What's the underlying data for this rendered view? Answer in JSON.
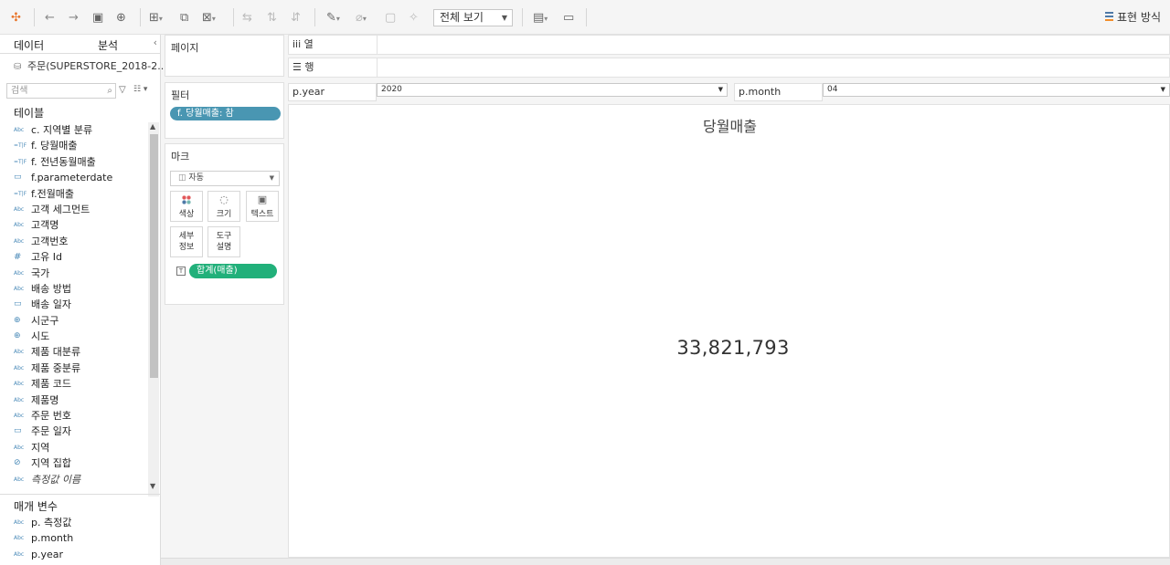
{
  "toolbar": {
    "icons": [
      "tableau-logo-icon",
      "undo-icon",
      "redo-icon",
      "save-icon",
      "new-datasource-icon",
      "new-worksheet-icon",
      "duplicate-icon",
      "clear-icon",
      "swap-icon",
      "sort-asc-icon",
      "sort-desc-icon",
      "highlight-icon",
      "group-icon",
      "label-icon",
      "pin-icon",
      "show-cards-icon",
      "presentation-icon"
    ],
    "view_mode": "전체 보기",
    "show_me": "표현 방식"
  },
  "data_pane": {
    "tab_data": "데이터",
    "tab_analysis": "분석",
    "datasource": "주문(SUPERSTORE_2018-2...",
    "search_placeholder": "검색",
    "tables_title": "테이블",
    "fields": [
      {
        "type": "Abc",
        "icon": "string-calc-icon",
        "label": "c. 지역별 분류"
      },
      {
        "type": "T|F",
        "icon": "boolean-calc-icon",
        "label": "f. 당월매출"
      },
      {
        "type": "T|F",
        "icon": "boolean-calc-icon",
        "label": "f. 전년동월매출"
      },
      {
        "type": "date",
        "icon": "date-calc-icon",
        "label": "f.parameterdate"
      },
      {
        "type": "T|F",
        "icon": "boolean-calc-icon",
        "label": "f.전월매출"
      },
      {
        "type": "Abc",
        "icon": "string-icon",
        "label": "고객 세그먼트"
      },
      {
        "type": "Abc",
        "icon": "string-icon",
        "label": "고객명"
      },
      {
        "type": "Abc",
        "icon": "string-icon",
        "label": "고객번호"
      },
      {
        "type": "#",
        "icon": "number-icon",
        "label": "고유 Id"
      },
      {
        "type": "Abc",
        "icon": "string-icon",
        "label": "국가"
      },
      {
        "type": "Abc",
        "icon": "string-icon",
        "label": "배송 방법"
      },
      {
        "type": "date",
        "icon": "date-icon",
        "label": "배송 일자"
      },
      {
        "type": "geo",
        "icon": "globe-icon",
        "label": "시군구"
      },
      {
        "type": "geo",
        "icon": "globe-icon",
        "label": "시도"
      },
      {
        "type": "Abc",
        "icon": "string-icon",
        "label": "제품 대분류"
      },
      {
        "type": "Abc",
        "icon": "string-icon",
        "label": "제품 중분류"
      },
      {
        "type": "Abc",
        "icon": "string-icon",
        "label": "제품 코드"
      },
      {
        "type": "Abc",
        "icon": "string-icon",
        "label": "제품명"
      },
      {
        "type": "Abc",
        "icon": "string-icon",
        "label": "주문 번호"
      },
      {
        "type": "date",
        "icon": "date-icon",
        "label": "주문 일자"
      },
      {
        "type": "Abc",
        "icon": "string-icon",
        "label": "지역"
      },
      {
        "type": "set",
        "icon": "set-icon",
        "label": "지역 집합"
      },
      {
        "type": "Abc",
        "icon": "string-icon",
        "label": "측정값 이름",
        "italic": true
      }
    ],
    "params_title": "매개 변수",
    "params": [
      {
        "type": "Abc",
        "icon": "string-icon",
        "label": "p. 측정값"
      },
      {
        "type": "Abc",
        "icon": "string-icon",
        "label": "p.month"
      },
      {
        "type": "Abc",
        "icon": "string-icon",
        "label": "p.year"
      }
    ]
  },
  "pages_card": {
    "title": "페이지"
  },
  "filters_card": {
    "title": "필터",
    "pill": "f. 당월매출: 참"
  },
  "marks_card": {
    "title": "마크",
    "type": "자동",
    "buttons": {
      "color": "색상",
      "size": "크기",
      "text": "텍스트",
      "detail_1": "세부",
      "detail_2": "정보",
      "tooltip_1": "도구",
      "tooltip_2": "설명"
    },
    "measure_pill": "합계(매출)"
  },
  "shelves": {
    "columns": "iii 열",
    "rows": "☰ 행"
  },
  "parameters": [
    {
      "label": "p.year",
      "value": "2020"
    },
    {
      "label": "p.month",
      "value": "04"
    }
  ],
  "view": {
    "title": "당월매출",
    "value": "33,821,793"
  }
}
